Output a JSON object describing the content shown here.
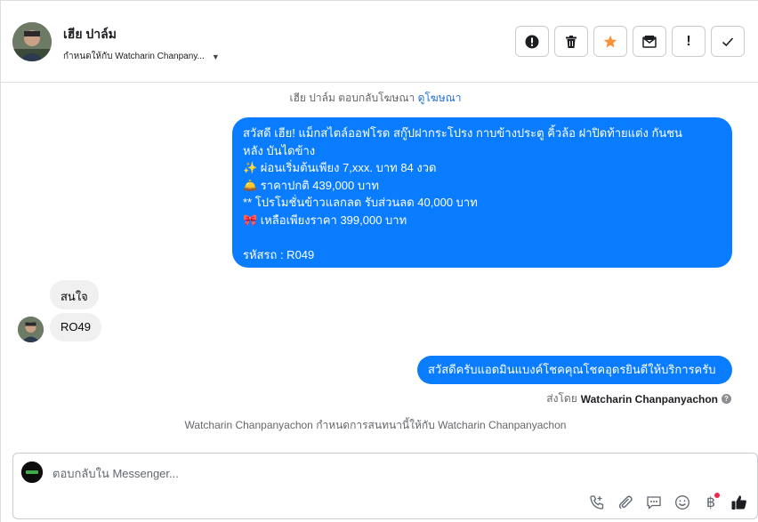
{
  "header": {
    "contact_name": "เฮีย ปาล์ม",
    "assigned_text": "กำหนดให้กับ Watcharin Chanpany..."
  },
  "actions": [
    {
      "name": "report-spam-button",
      "icon": "exclamation-circle-icon"
    },
    {
      "name": "delete-button",
      "icon": "trash-icon"
    },
    {
      "name": "star-button",
      "icon": "star-icon"
    },
    {
      "name": "mark-unread-button",
      "icon": "envelope-icon"
    },
    {
      "name": "follow-up-button",
      "icon": "exclamation-icon"
    },
    {
      "name": "mark-done-button",
      "icon": "check-icon"
    }
  ],
  "thread": {
    "ad_reply_text": "เฮีย ปาล์ม ตอบกลับโฆษณา",
    "ad_link_text": "ดูโฆษณา",
    "outgoing_1": [
      "สวัสดี เฮีย! แม็กสไตล์ออฟโรด สกู๊ปฝากระโปรง กาบข้างประตู คิ้วล้อ ฝาปิดท้ายแต่ง กันชน",
      "หลัง บันไดข้าง",
      "✨  ผ่อนเริ่มต้นเพียง 7,xxx. บาท 84 งวด",
      "🛎️ ราคาปกติ 439,000 บาท",
      "** โปรโมชั่นข้าวแลกลด รับส่วนลด 40,000 บาท",
      "🎀  เหลือเพียงราคา 399,000 บาท",
      "",
      " รหัสรถ : R049"
    ],
    "incoming_1": "สนใจ",
    "incoming_2": "RO49",
    "outgoing_2": "สวัสดีครับแอดมินแบงค์โชคคุณโชคอุดรยินดีให้บริการครับ",
    "sent_by_label": "ส่งโดย",
    "sent_by_name": "Watcharin Chanpanyachon",
    "assignment_note": "Watcharin Chanpanyachon กำหนดการสนทนานี้ให้กับ Watcharin Chanpanyachon"
  },
  "composer": {
    "placeholder": "ตอบกลับใน Messenger...",
    "tools": [
      "phone-add-icon",
      "paperclip-icon",
      "chat-bubble-icon",
      "emoji-icon",
      "baht-icon",
      "thumbs-up-icon"
    ]
  },
  "colors": {
    "accent": "#0a7cff",
    "incoming_bubble": "#f0f0f0",
    "star": "#f7923b"
  }
}
